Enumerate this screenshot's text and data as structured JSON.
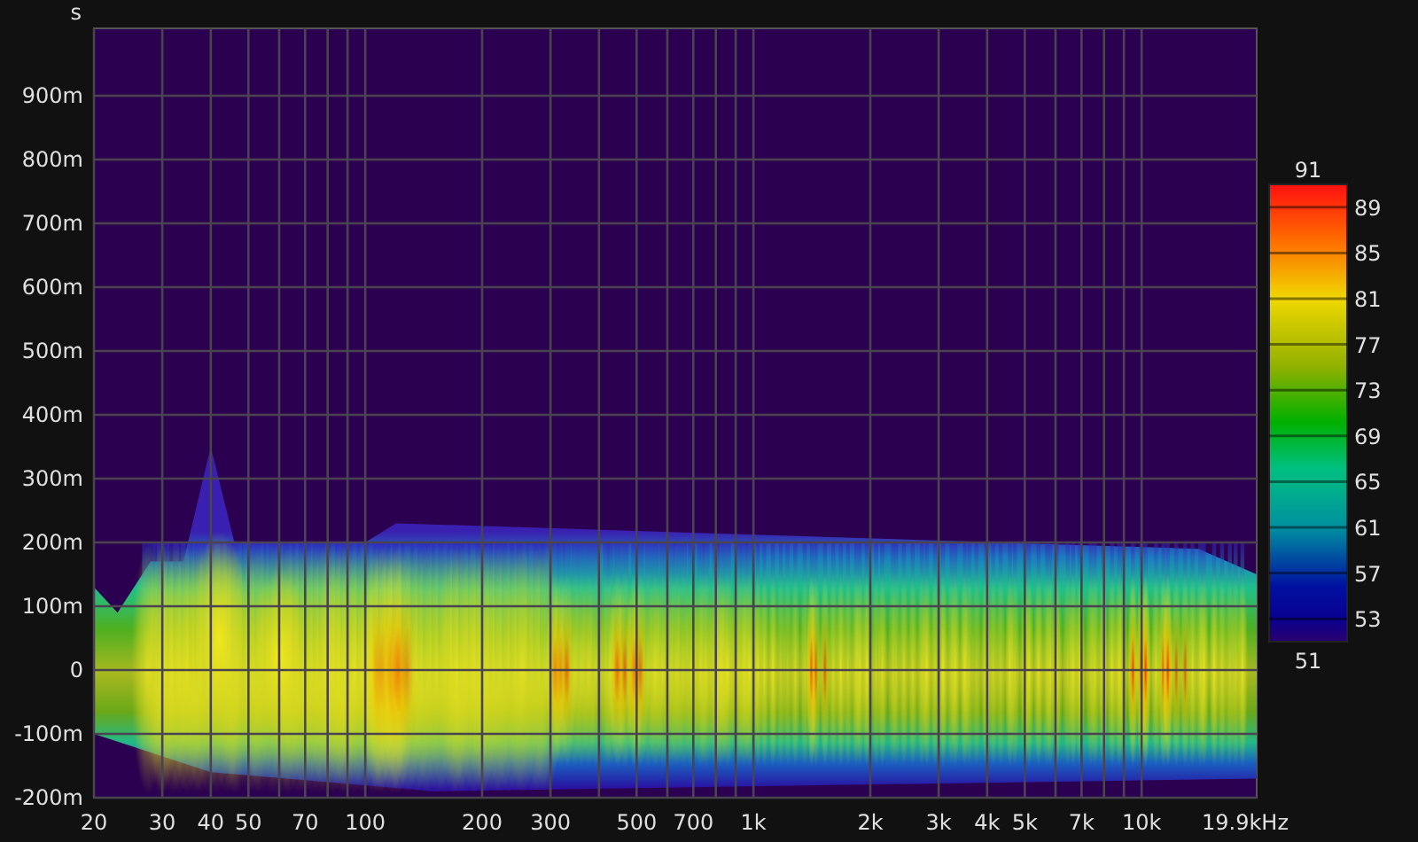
{
  "plot": {
    "y_unit": "s",
    "y_ticks": [
      "900m",
      "800m",
      "700m",
      "600m",
      "500m",
      "400m",
      "300m",
      "200m",
      "100m",
      "0",
      "-100m",
      "-200m"
    ],
    "x_ticks": [
      "20",
      "30",
      "40",
      "50",
      "70",
      "100",
      "200",
      "300",
      "500",
      "700",
      "1k",
      "2k",
      "3k",
      "4k",
      "5k",
      "7k",
      "10k",
      "19.9kHz"
    ]
  },
  "colorbar": {
    "max_label": "91",
    "min_label": "51",
    "ticks": [
      "89",
      "85",
      "81",
      "77",
      "73",
      "69",
      "65",
      "61",
      "57",
      "53"
    ]
  }
}
